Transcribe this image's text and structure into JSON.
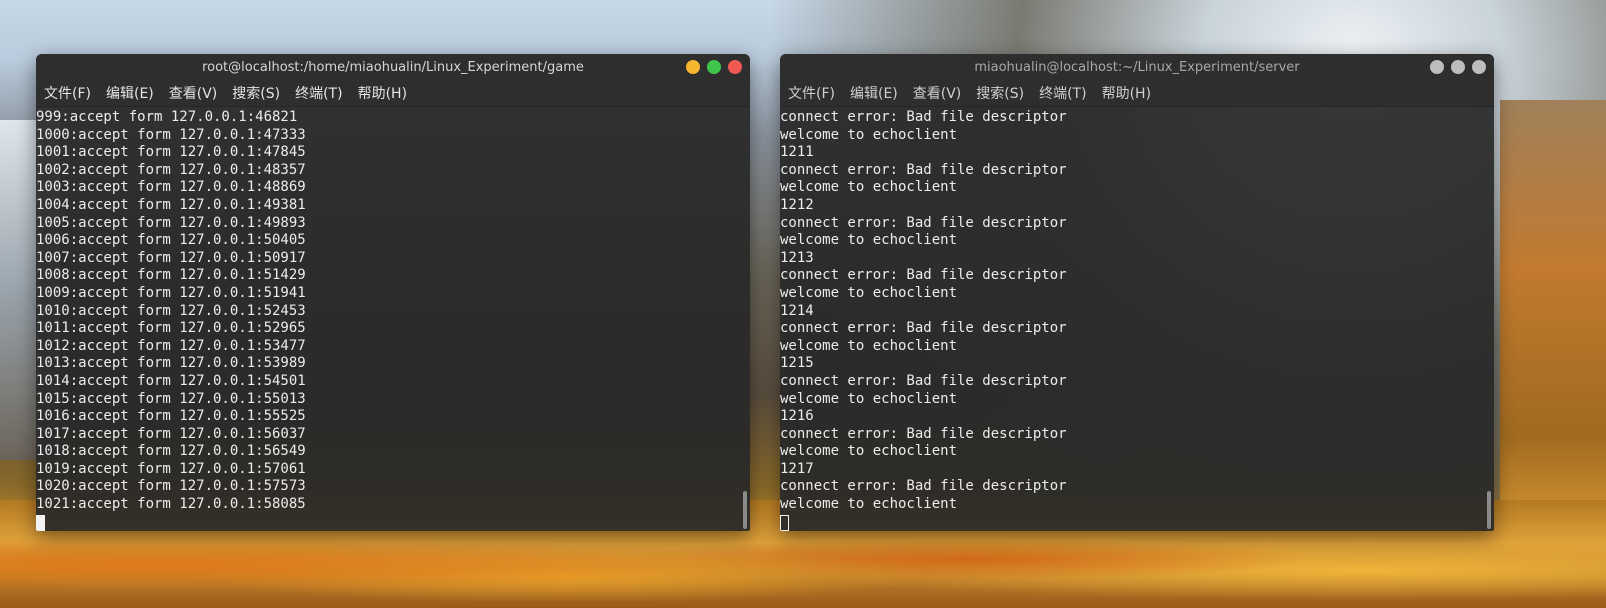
{
  "left_window": {
    "title": "root@localhost:/home/miaohualin/Linux_Experiment/game",
    "menu": [
      "文件(F)",
      "编辑(E)",
      "查看(V)",
      "搜索(S)",
      "终端(T)",
      "帮助(H)"
    ],
    "lines": [
      "999:accept form 127.0.0.1:46821",
      "1000:accept form 127.0.0.1:47333",
      "1001:accept form 127.0.0.1:47845",
      "1002:accept form 127.0.0.1:48357",
      "1003:accept form 127.0.0.1:48869",
      "1004:accept form 127.0.0.1:49381",
      "1005:accept form 127.0.0.1:49893",
      "1006:accept form 127.0.0.1:50405",
      "1007:accept form 127.0.0.1:50917",
      "1008:accept form 127.0.0.1:51429",
      "1009:accept form 127.0.0.1:51941",
      "1010:accept form 127.0.0.1:52453",
      "1011:accept form 127.0.0.1:52965",
      "1012:accept form 127.0.0.1:53477",
      "1013:accept form 127.0.0.1:53989",
      "1014:accept form 127.0.0.1:54501",
      "1015:accept form 127.0.0.1:55013",
      "1016:accept form 127.0.0.1:55525",
      "1017:accept form 127.0.0.1:56037",
      "1018:accept form 127.0.0.1:56549",
      "1019:accept form 127.0.0.1:57061",
      "1020:accept form 127.0.0.1:57573",
      "1021:accept form 127.0.0.1:58085"
    ],
    "controls": [
      "minimize-icon",
      "maximize-icon",
      "close-icon"
    ]
  },
  "right_window": {
    "title": "miaohualin@localhost:~/Linux_Experiment/server",
    "menu": [
      "文件(F)",
      "编辑(E)",
      "查看(V)",
      "搜索(S)",
      "终端(T)",
      "帮助(H)"
    ],
    "lines": [
      "connect error: Bad file descriptor",
      "welcome to echoclient",
      "1211",
      "connect error: Bad file descriptor",
      "welcome to echoclient",
      "1212",
      "connect error: Bad file descriptor",
      "welcome to echoclient",
      "1213",
      "connect error: Bad file descriptor",
      "welcome to echoclient",
      "1214",
      "connect error: Bad file descriptor",
      "welcome to echoclient",
      "1215",
      "connect error: Bad file descriptor",
      "welcome to echoclient",
      "1216",
      "connect error: Bad file descriptor",
      "welcome to echoclient",
      "1217",
      "connect error: Bad file descriptor",
      "welcome to echoclient"
    ],
    "controls": [
      "minimize-icon",
      "maximize-icon",
      "close-icon"
    ]
  },
  "colors": {
    "terminal_bg": "#282828",
    "text": "#ececec",
    "minimize": "#f5b72e",
    "maximize": "#3fc64a",
    "close": "#f05a52",
    "inactive_button": "#bdbdbd"
  }
}
